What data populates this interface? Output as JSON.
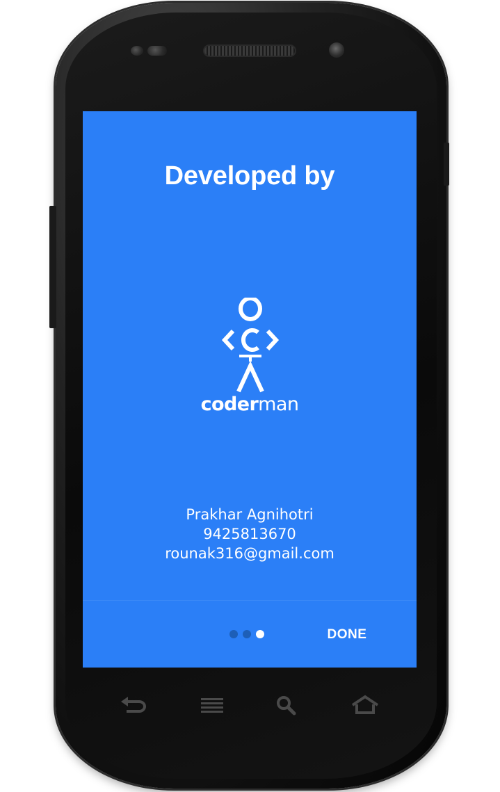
{
  "screen": {
    "title": "Developed by",
    "background_color": "#2b7ff7",
    "logo": {
      "caption_bold": "coder",
      "caption_light": "man"
    },
    "contact": {
      "name": "Prakhar Agnihotri",
      "phone": "9425813670",
      "email": "rounak316@gmail.com"
    },
    "pager": {
      "total_pages": 3,
      "current_page": 3
    },
    "done_label": "DONE"
  },
  "device": {
    "nav_keys": [
      "back-icon",
      "menu-icon",
      "search-icon",
      "home-icon"
    ]
  }
}
